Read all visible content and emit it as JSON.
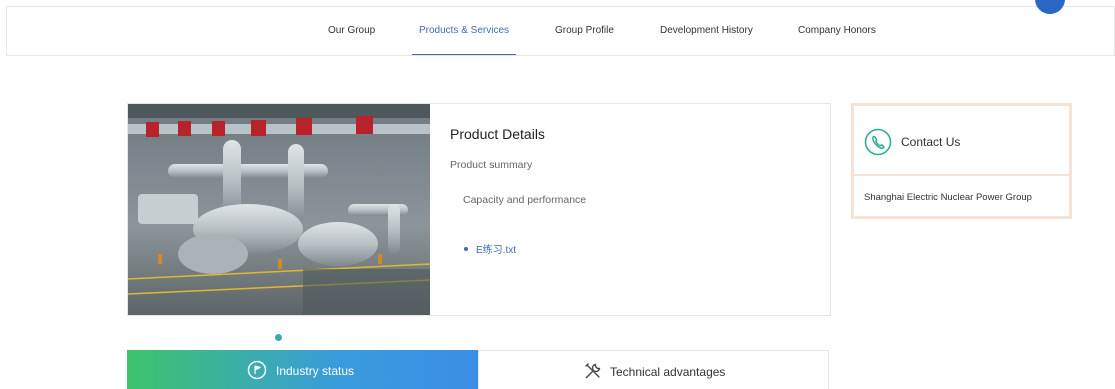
{
  "nav": {
    "items": [
      {
        "label": "Our Group"
      },
      {
        "label": "Products & Services"
      },
      {
        "label": "Group Profile"
      },
      {
        "label": "Development History"
      },
      {
        "label": "Company Honors"
      }
    ],
    "active_index": 1
  },
  "product": {
    "title": "Product Details",
    "summary": "Product summary",
    "capacity": "Capacity and performance",
    "file": "E练习.txt",
    "image_icon": "industrial-turbine-photo"
  },
  "contact": {
    "title": "Contact Us",
    "company": "Shanghai Electric Nuclear Power Group",
    "icon": "phone-icon"
  },
  "tabs": [
    {
      "label": "Industry status",
      "icon": "flag-icon"
    },
    {
      "label": "Technical advantages",
      "icon": "tools-icon"
    }
  ],
  "colors": {
    "accent": "#3a6fb5",
    "contact_border": "#f6e3d6",
    "contact_icon": "#2fae9a",
    "tab_gradient_start": "#3cc46a",
    "tab_gradient_end": "#3b8ee6",
    "pager_dot": "#3aa8b8"
  }
}
